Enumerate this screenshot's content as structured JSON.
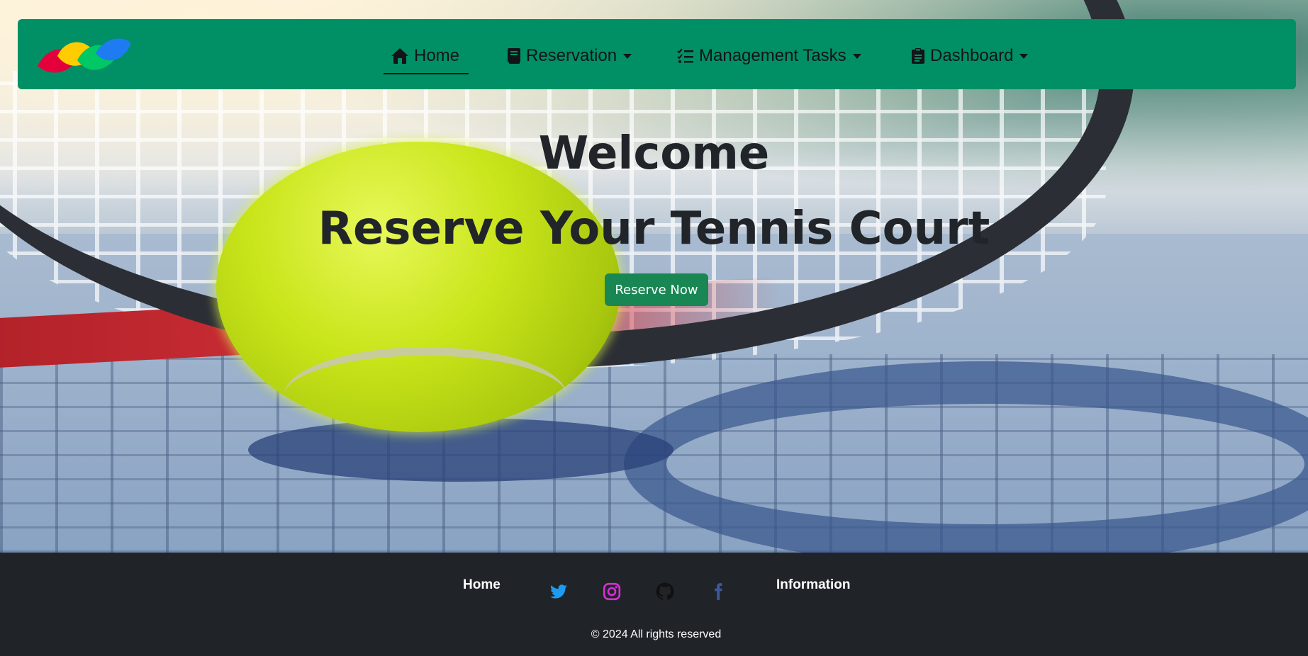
{
  "navbar": {
    "logo_icon": "colorful-leaves-logo",
    "items": [
      {
        "label": "Home",
        "icon": "house-icon",
        "active": true,
        "dropdown": false
      },
      {
        "label": "Reservation",
        "icon": "book-icon",
        "active": false,
        "dropdown": true
      },
      {
        "label": "Management Tasks",
        "icon": "checklist-icon",
        "active": false,
        "dropdown": true
      },
      {
        "label": "Dashboard",
        "icon": "clipboard-icon",
        "active": false,
        "dropdown": true
      }
    ],
    "background_color": "#018f66"
  },
  "hero": {
    "title": "Welcome",
    "subtitle": "Reserve Your Tennis Court",
    "cta_label": "Reserve Now",
    "cta_color": "#198754"
  },
  "footer": {
    "links": [
      {
        "label": "Home"
      },
      {
        "label": "Information"
      }
    ],
    "social": [
      {
        "icon": "twitter-icon",
        "color": "#1d9bf0"
      },
      {
        "icon": "instagram-icon",
        "color": "#d62fd6"
      },
      {
        "icon": "github-icon",
        "color": "#111111"
      },
      {
        "icon": "facebook-icon",
        "color": "#3b5998"
      }
    ],
    "copyright": "© 2024 All rights reserved",
    "background_color": "#202328"
  }
}
